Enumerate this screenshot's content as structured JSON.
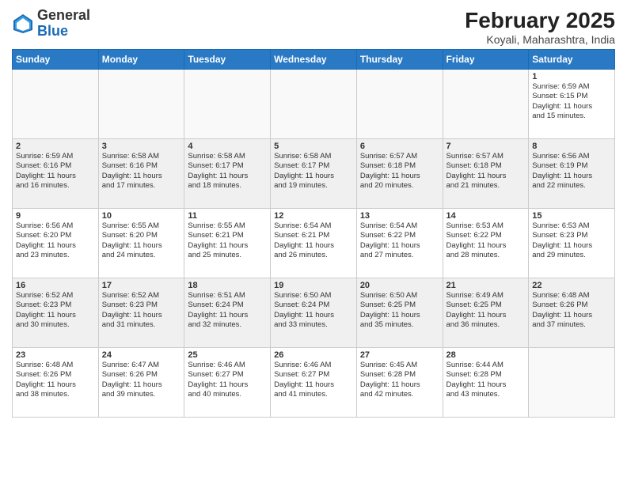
{
  "header": {
    "logo_general": "General",
    "logo_blue": "Blue",
    "title": "February 2025",
    "location": "Koyali, Maharashtra, India"
  },
  "days_of_week": [
    "Sunday",
    "Monday",
    "Tuesday",
    "Wednesday",
    "Thursday",
    "Friday",
    "Saturday"
  ],
  "weeks": [
    [
      {
        "day": "",
        "info": ""
      },
      {
        "day": "",
        "info": ""
      },
      {
        "day": "",
        "info": ""
      },
      {
        "day": "",
        "info": ""
      },
      {
        "day": "",
        "info": ""
      },
      {
        "day": "",
        "info": ""
      },
      {
        "day": "1",
        "info": "Sunrise: 6:59 AM\nSunset: 6:15 PM\nDaylight: 11 hours\nand 15 minutes."
      }
    ],
    [
      {
        "day": "2",
        "info": "Sunrise: 6:59 AM\nSunset: 6:16 PM\nDaylight: 11 hours\nand 16 minutes."
      },
      {
        "day": "3",
        "info": "Sunrise: 6:58 AM\nSunset: 6:16 PM\nDaylight: 11 hours\nand 17 minutes."
      },
      {
        "day": "4",
        "info": "Sunrise: 6:58 AM\nSunset: 6:17 PM\nDaylight: 11 hours\nand 18 minutes."
      },
      {
        "day": "5",
        "info": "Sunrise: 6:58 AM\nSunset: 6:17 PM\nDaylight: 11 hours\nand 19 minutes."
      },
      {
        "day": "6",
        "info": "Sunrise: 6:57 AM\nSunset: 6:18 PM\nDaylight: 11 hours\nand 20 minutes."
      },
      {
        "day": "7",
        "info": "Sunrise: 6:57 AM\nSunset: 6:18 PM\nDaylight: 11 hours\nand 21 minutes."
      },
      {
        "day": "8",
        "info": "Sunrise: 6:56 AM\nSunset: 6:19 PM\nDaylight: 11 hours\nand 22 minutes."
      }
    ],
    [
      {
        "day": "9",
        "info": "Sunrise: 6:56 AM\nSunset: 6:20 PM\nDaylight: 11 hours\nand 23 minutes."
      },
      {
        "day": "10",
        "info": "Sunrise: 6:55 AM\nSunset: 6:20 PM\nDaylight: 11 hours\nand 24 minutes."
      },
      {
        "day": "11",
        "info": "Sunrise: 6:55 AM\nSunset: 6:21 PM\nDaylight: 11 hours\nand 25 minutes."
      },
      {
        "day": "12",
        "info": "Sunrise: 6:54 AM\nSunset: 6:21 PM\nDaylight: 11 hours\nand 26 minutes."
      },
      {
        "day": "13",
        "info": "Sunrise: 6:54 AM\nSunset: 6:22 PM\nDaylight: 11 hours\nand 27 minutes."
      },
      {
        "day": "14",
        "info": "Sunrise: 6:53 AM\nSunset: 6:22 PM\nDaylight: 11 hours\nand 28 minutes."
      },
      {
        "day": "15",
        "info": "Sunrise: 6:53 AM\nSunset: 6:23 PM\nDaylight: 11 hours\nand 29 minutes."
      }
    ],
    [
      {
        "day": "16",
        "info": "Sunrise: 6:52 AM\nSunset: 6:23 PM\nDaylight: 11 hours\nand 30 minutes."
      },
      {
        "day": "17",
        "info": "Sunrise: 6:52 AM\nSunset: 6:23 PM\nDaylight: 11 hours\nand 31 minutes."
      },
      {
        "day": "18",
        "info": "Sunrise: 6:51 AM\nSunset: 6:24 PM\nDaylight: 11 hours\nand 32 minutes."
      },
      {
        "day": "19",
        "info": "Sunrise: 6:50 AM\nSunset: 6:24 PM\nDaylight: 11 hours\nand 33 minutes."
      },
      {
        "day": "20",
        "info": "Sunrise: 6:50 AM\nSunset: 6:25 PM\nDaylight: 11 hours\nand 35 minutes."
      },
      {
        "day": "21",
        "info": "Sunrise: 6:49 AM\nSunset: 6:25 PM\nDaylight: 11 hours\nand 36 minutes."
      },
      {
        "day": "22",
        "info": "Sunrise: 6:48 AM\nSunset: 6:26 PM\nDaylight: 11 hours\nand 37 minutes."
      }
    ],
    [
      {
        "day": "23",
        "info": "Sunrise: 6:48 AM\nSunset: 6:26 PM\nDaylight: 11 hours\nand 38 minutes."
      },
      {
        "day": "24",
        "info": "Sunrise: 6:47 AM\nSunset: 6:26 PM\nDaylight: 11 hours\nand 39 minutes."
      },
      {
        "day": "25",
        "info": "Sunrise: 6:46 AM\nSunset: 6:27 PM\nDaylight: 11 hours\nand 40 minutes."
      },
      {
        "day": "26",
        "info": "Sunrise: 6:46 AM\nSunset: 6:27 PM\nDaylight: 11 hours\nand 41 minutes."
      },
      {
        "day": "27",
        "info": "Sunrise: 6:45 AM\nSunset: 6:28 PM\nDaylight: 11 hours\nand 42 minutes."
      },
      {
        "day": "28",
        "info": "Sunrise: 6:44 AM\nSunset: 6:28 PM\nDaylight: 11 hours\nand 43 minutes."
      },
      {
        "day": "",
        "info": ""
      }
    ]
  ]
}
